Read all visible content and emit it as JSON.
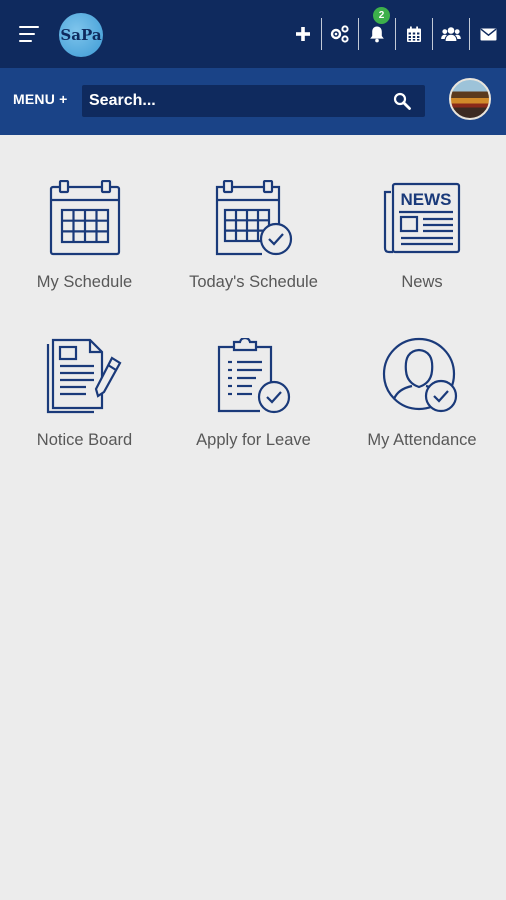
{
  "header": {
    "logo_text": "SaPa",
    "notification_count": "2",
    "actions": [
      {
        "icon": "plus-icon"
      },
      {
        "icon": "share-settings-icon"
      },
      {
        "icon": "bell-icon"
      },
      {
        "icon": "calendar-icon"
      },
      {
        "icon": "users-icon"
      },
      {
        "icon": "mail-icon"
      }
    ]
  },
  "search": {
    "menu_label": "MENU +",
    "placeholder": "Search..."
  },
  "tiles": [
    {
      "label": "My Schedule",
      "icon": "calendar-grid-icon"
    },
    {
      "label": "Today's Schedule",
      "icon": "calendar-check-icon"
    },
    {
      "label": "News",
      "icon": "newspaper-icon"
    },
    {
      "label": "Notice Board",
      "icon": "notice-board-icon"
    },
    {
      "label": "Apply for Leave",
      "icon": "clipboard-check-icon"
    },
    {
      "label": "My Attendance",
      "icon": "user-check-icon"
    }
  ],
  "colors": {
    "header_bg": "#0f2a5e",
    "search_bar_bg": "#1a4387",
    "icon_stroke": "#1a3a7a",
    "badge": "#3db04b",
    "page_bg": "#ececec"
  }
}
